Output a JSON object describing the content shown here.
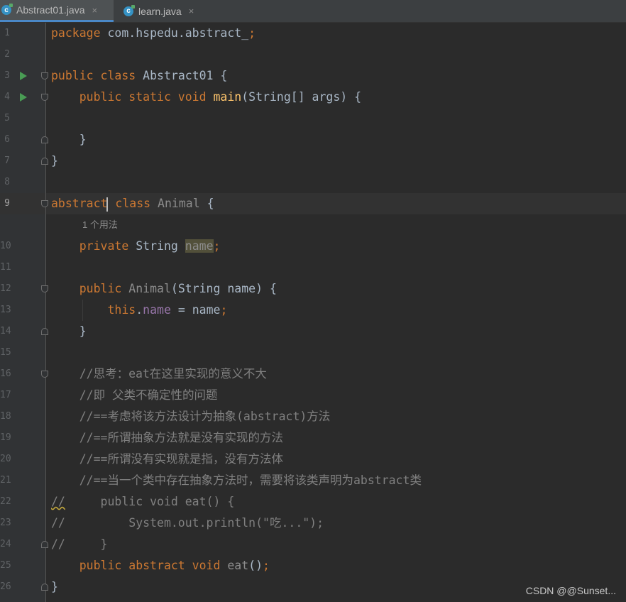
{
  "tabs": [
    {
      "label": "Abstract01.java",
      "icon": "java-class-icon",
      "active": true
    },
    {
      "label": "learn.java",
      "icon": "java-class-icon",
      "active": false
    }
  ],
  "tab_close_glyph": "×",
  "tab_icon_letter": "c",
  "line_numbers": [
    "1",
    "2",
    "3",
    "4",
    "5",
    "6",
    "7",
    "8",
    "9",
    "10",
    "11",
    "12",
    "13",
    "14",
    "15",
    "16",
    "17",
    "18",
    "19",
    "20",
    "21",
    "22",
    "23",
    "24",
    "25",
    "26"
  ],
  "current_line": "9",
  "usage_hint": "1 个用法",
  "code": {
    "l1_kw": "package",
    "l1_rest": " com.hspedu.abstract_",
    "l1_semi": ";",
    "l3_kw": "public class",
    "l3_name": " Abstract01 {",
    "l4_kw": "    public static void",
    "l4_fn": " main",
    "l4_rest": "(String[] args) {",
    "l6": "    }",
    "l7": "}",
    "l9_kw": "abstract",
    "l9_kw2": " class",
    "l9_name": " Animal",
    "l9_rest": " {",
    "l10_kw": "    private",
    "l10_type": " String ",
    "l10_field": "name",
    "l10_semi": ";",
    "l12_kw": "    public",
    "l12_ctor": " Animal",
    "l12_rest": "(String name) {",
    "l13_kw": "        this",
    "l13_dot": ".",
    "l13_field": "name",
    "l13_rest": " = name",
    "l13_semi": ";",
    "l14": "    }",
    "l16": "    //思考：eat在这里实现的意义不大",
    "l17": "    //即 父类不确定性的问题",
    "l18": "    //==考虑将该方法设计为抽象(abstract)方法",
    "l19": "    //==所谓抽象方法就是没有实现的方法",
    "l20": "    //==所谓没有实现就是指，没有方法体",
    "l21": "    //==当一个类中存在抽象方法时，需要将该类声明为abstract类",
    "l22_slash": "//",
    "l22_rest": "     public void eat() {",
    "l23": "//         System.out.println(\"吃...\");",
    "l24": "//     }",
    "l25_kw": "    public abstract void",
    "l25_fn": " eat",
    "l25_rest": "()",
    "l25_semi": ";",
    "l26": "}"
  },
  "watermark": "CSDN @@Sunset...",
  "colors": {
    "keyword": "#cc7832",
    "method": "#ffc66d",
    "field": "#9876aa",
    "comment": "#808080",
    "text": "#a9b7c6",
    "background": "#2b2b2b"
  }
}
